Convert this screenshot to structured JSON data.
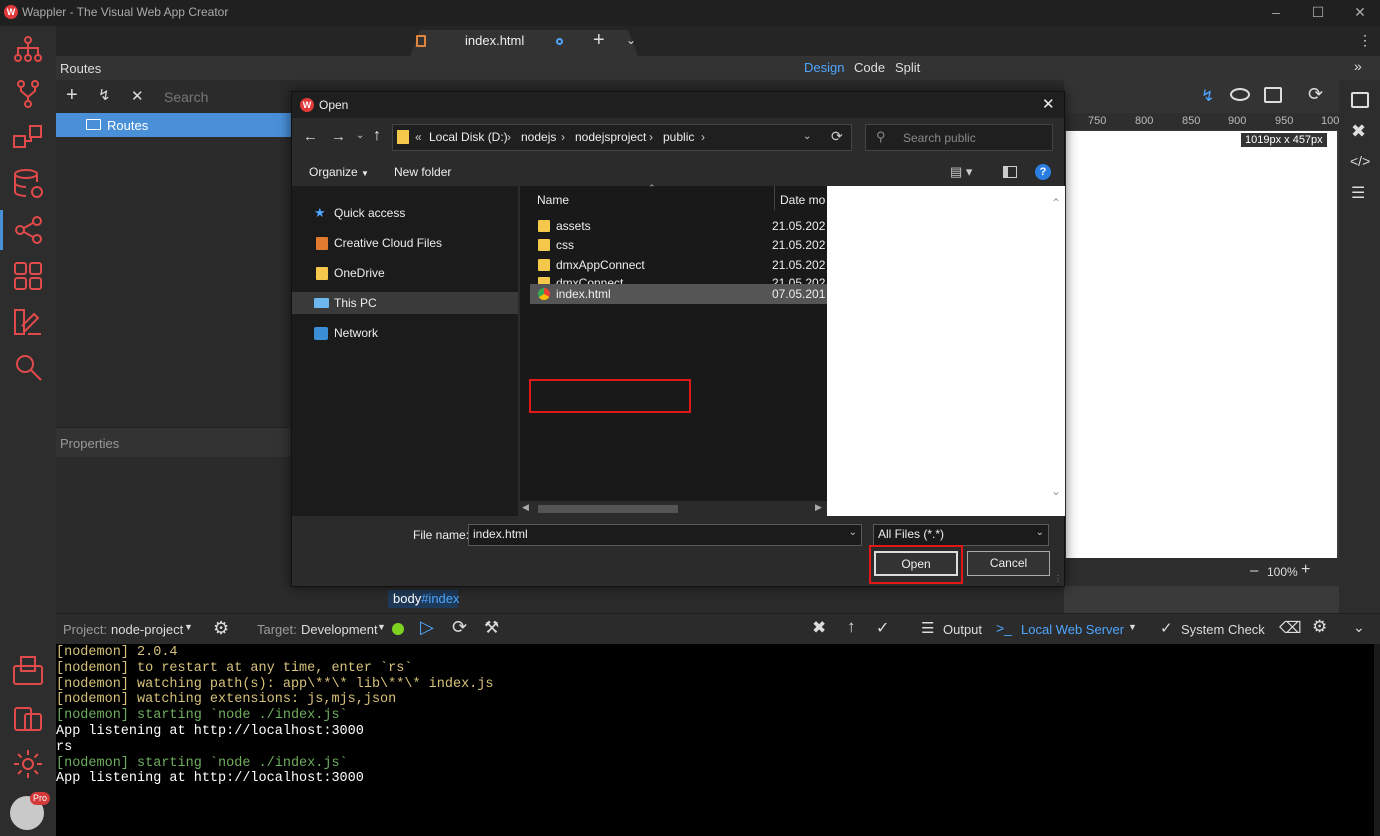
{
  "app": {
    "title": "Wappler - The Visual Web App Creator",
    "logo_letter": "W"
  },
  "tab": {
    "label": "index.html"
  },
  "view_modes": {
    "design": "Design",
    "code": "Code",
    "split": "Split"
  },
  "routes": {
    "header": "Routes",
    "search_placeholder": "Search",
    "tree_item": "Routes"
  },
  "properties": {
    "header": "Properties"
  },
  "ruler": {
    "ticks": [
      "750",
      "800",
      "850",
      "900",
      "950",
      "100"
    ]
  },
  "canvas": {
    "size_badge": "1019px x 457px",
    "zoom": "100%"
  },
  "breadcrumb": {
    "element": "body",
    "id": "#index"
  },
  "dialog": {
    "title": "Open",
    "address": {
      "prefix": "«",
      "parts": [
        "Local Disk (D:)",
        "nodejs",
        "nodejsproject",
        "public"
      ]
    },
    "search_placeholder": "Search public",
    "organize": "Organize",
    "new_folder": "New folder",
    "nav": [
      {
        "label": "Quick access",
        "icon": "star-icon"
      },
      {
        "label": "Creative Cloud Files",
        "icon": "cloud-folder-icon"
      },
      {
        "label": "OneDrive",
        "icon": "folder-icon"
      },
      {
        "label": "This PC",
        "icon": "computer-icon"
      },
      {
        "label": "Network",
        "icon": "network-icon"
      }
    ],
    "columns": {
      "name": "Name",
      "date": "Date mo"
    },
    "files": [
      {
        "name": "assets",
        "date": "21.05.202"
      },
      {
        "name": "css",
        "date": "21.05.202"
      },
      {
        "name": "dmxAppConnect",
        "date": "21.05.202"
      },
      {
        "name": "dmxConnect",
        "date": "21.05.202"
      },
      {
        "name": "index.html",
        "date": "07.05.201"
      }
    ],
    "filename_label": "File name:",
    "filename_value": "index.html",
    "filetype_value": "All Files (*.*)",
    "open_label": "Open",
    "cancel_label": "Cancel"
  },
  "statusbar": {
    "project_label": "Project:",
    "project_value": "node-project",
    "target_label": "Target:",
    "target_value": "Development",
    "output": "Output",
    "local_server": "Local Web Server",
    "system_check": "System Check"
  },
  "terminal": {
    "lines": [
      {
        "text": "[nodemon] 2.0.4",
        "color": "#d6c27a"
      },
      {
        "text": "[nodemon] to restart at any time, enter `rs`",
        "color": "#d6c27a"
      },
      {
        "text": "[nodemon] watching path(s): app\\**\\* lib\\**\\* index.js",
        "color": "#d6c27a"
      },
      {
        "text": "[nodemon] watching extensions: js,mjs,json",
        "color": "#d6c27a"
      },
      {
        "text": "[nodemon] starting `node ./index.js`",
        "color": "#6fae5f"
      },
      {
        "text": "App listening at http://localhost:3000",
        "color": "#ffffff"
      },
      {
        "text": "rs",
        "color": "#ffffff"
      },
      {
        "text": "[nodemon] starting `node ./index.js`",
        "color": "#6fae5f"
      },
      {
        "text": "App listening at http://localhost:3000",
        "color": "#ffffff"
      }
    ]
  },
  "avatar": {
    "badge": "Pro"
  },
  "colors": {
    "accent": "#4a90d9",
    "highlight": "#e01818",
    "status_ok": "#7ed321"
  }
}
